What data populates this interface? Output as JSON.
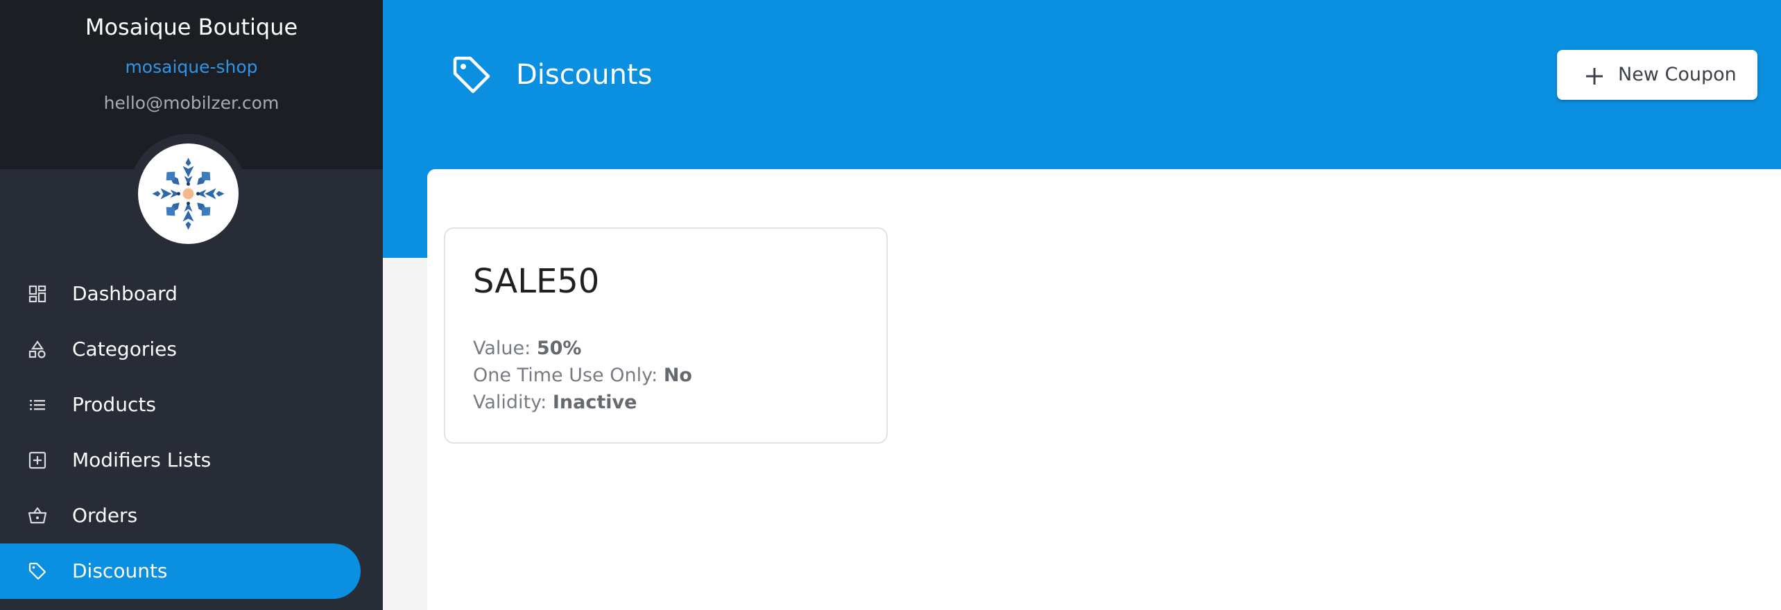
{
  "shop": {
    "name": "Mosaique Boutique",
    "slug": "mosaique-shop",
    "email": "hello@mobilzer.com",
    "logo_icon": "mosaic-snowflake-logo"
  },
  "nav": {
    "items": [
      {
        "label": "Dashboard",
        "icon": "dashboard-grid-icon"
      },
      {
        "label": "Categories",
        "icon": "shapes-icon"
      },
      {
        "label": "Products",
        "icon": "list-icon"
      },
      {
        "label": "Modifiers Lists",
        "icon": "plus-box-icon"
      },
      {
        "label": "Orders",
        "icon": "basket-icon"
      },
      {
        "label": "Discounts",
        "icon": "tag-icon",
        "active": true
      }
    ]
  },
  "header": {
    "title": "Discounts",
    "icon": "tag-icon",
    "new_button_label": "New Coupon"
  },
  "coupons": [
    {
      "code": "SALE50",
      "value_label": "Value:",
      "value": "50%",
      "one_time_label": "One Time Use Only:",
      "one_time": "No",
      "validity_label": "Validity:",
      "validity": "Inactive"
    }
  ],
  "colors": {
    "accent": "#0a8fe1",
    "sidebar": "#272c36",
    "sidebar_head": "#1b1e23",
    "slug": "#2f95e6"
  }
}
